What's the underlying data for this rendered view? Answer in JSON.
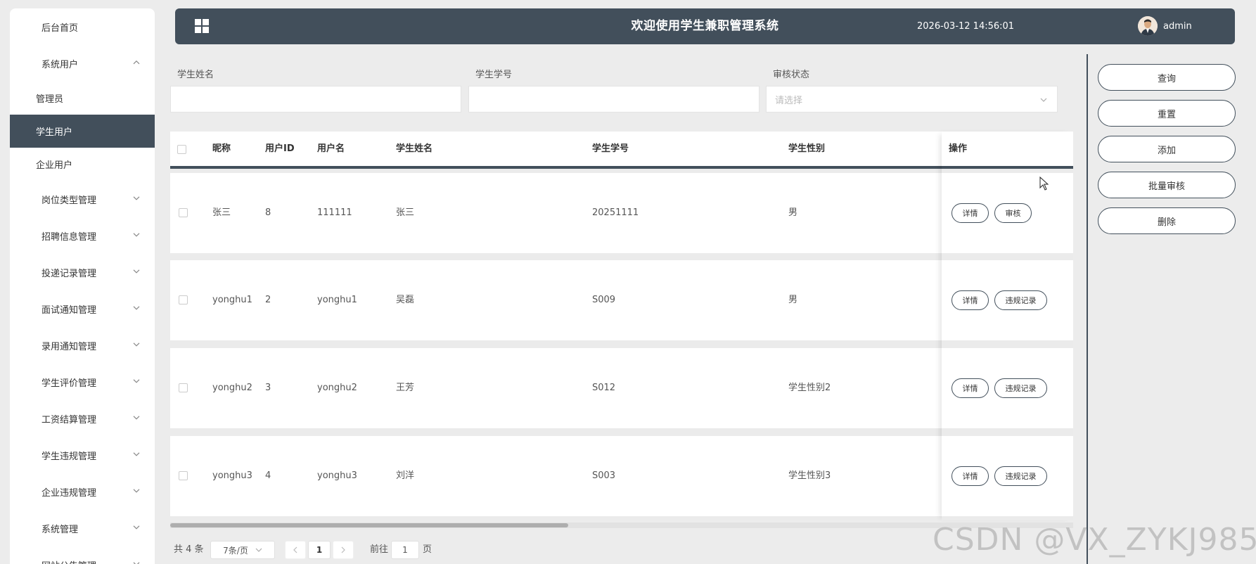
{
  "header": {
    "title": "欢迎使用学生兼职管理系统",
    "datetime": "2026-03-12 14:56:01",
    "username": "admin"
  },
  "sidebar": {
    "home": "后台首页",
    "system_users": "系统用户",
    "sub_items": [
      "管理员",
      "学生用户",
      "企业用户"
    ],
    "menus": [
      "岗位类型管理",
      "招聘信息管理",
      "投递记录管理",
      "面试通知管理",
      "录用通知管理",
      "学生评价管理",
      "工资结算管理",
      "学生违规管理",
      "企业违规管理",
      "系统管理",
      "网站公告管理"
    ]
  },
  "search": {
    "name_label": "学生姓名",
    "name_value": "",
    "number_label": "学生学号",
    "number_value": "",
    "status_label": "审核状态",
    "status_placeholder": "请选择"
  },
  "table": {
    "headers": {
      "nickname": "昵称",
      "user_id": "用户ID",
      "username": "用户名",
      "student_name": "学生姓名",
      "student_no": "学生学号",
      "gender": "学生性别",
      "actions": "操作"
    },
    "rows": [
      {
        "nickname": "张三",
        "user_id": "8",
        "username": "111111",
        "student_name": "张三",
        "student_no": "20251111",
        "gender": "男",
        "btn1": "详情",
        "btn2": "审核"
      },
      {
        "nickname": "yonghu1",
        "user_id": "2",
        "username": "yonghu1",
        "student_name": "吴磊",
        "student_no": "S009",
        "gender": "男",
        "btn1": "详情",
        "btn2": "违规记录"
      },
      {
        "nickname": "yonghu2",
        "user_id": "3",
        "username": "yonghu2",
        "student_name": "王芳",
        "student_no": "S012",
        "gender": "学生性别2",
        "btn1": "详情",
        "btn2": "违规记录"
      },
      {
        "nickname": "yonghu3",
        "user_id": "4",
        "username": "yonghu3",
        "student_name": "刘洋",
        "student_no": "S003",
        "gender": "学生性别3",
        "btn1": "详情",
        "btn2": "违规记录"
      }
    ]
  },
  "pagination": {
    "total": "共 4 条",
    "page_size": "7条/页",
    "current_page": "1",
    "goto_prefix": "前往",
    "goto_value": "1",
    "goto_suffix": "页"
  },
  "actions": {
    "query": "查询",
    "reset": "重置",
    "add": "添加",
    "batch_review": "批量审核",
    "delete": "删除"
  },
  "watermark": "CSDN @VX_ZYKJ985",
  "colors": {
    "primary": "#424f5b",
    "background": "#ececec"
  }
}
